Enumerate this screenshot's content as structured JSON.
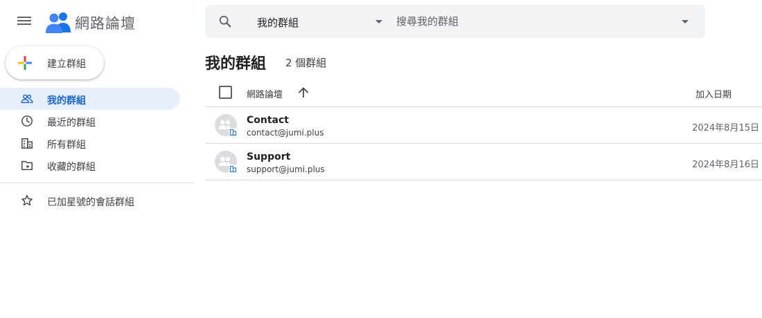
{
  "header": {
    "app_title": "網路論壇",
    "menu_icon": "hamburger-menu-icon",
    "logo_icon": "groups-people-icon"
  },
  "search": {
    "scope": "我的群組",
    "placeholder": "搜尋我的群組"
  },
  "sidebar": {
    "create_label": "建立群組",
    "items": [
      {
        "label": "我的群組",
        "icon": "people-icon",
        "active": true
      },
      {
        "label": "最近的群組",
        "icon": "clock-icon",
        "active": false
      },
      {
        "label": "所有群組",
        "icon": "building-icon",
        "active": false
      },
      {
        "label": "收藏的群組",
        "icon": "folder-star-icon",
        "active": false
      }
    ],
    "secondary_items": [
      {
        "label": "已加星號的會話群組",
        "icon": "star-icon",
        "active": false
      }
    ]
  },
  "main": {
    "title": "我的群組",
    "count_label": "2 個群組",
    "columns": {
      "name": "網路論壇",
      "date": "加入日期"
    },
    "rows": [
      {
        "name": "Contact",
        "email": "contact@jumi.plus",
        "date": "2024年8月15日"
      },
      {
        "name": "Support",
        "email": "support@jumi.plus",
        "date": "2024年8月16日"
      }
    ]
  },
  "colors": {
    "accent": "#1967d2",
    "active_bg": "#e8f0fe",
    "logo_blue": "#1a73e8",
    "search_bg": "#f1f3f4"
  }
}
